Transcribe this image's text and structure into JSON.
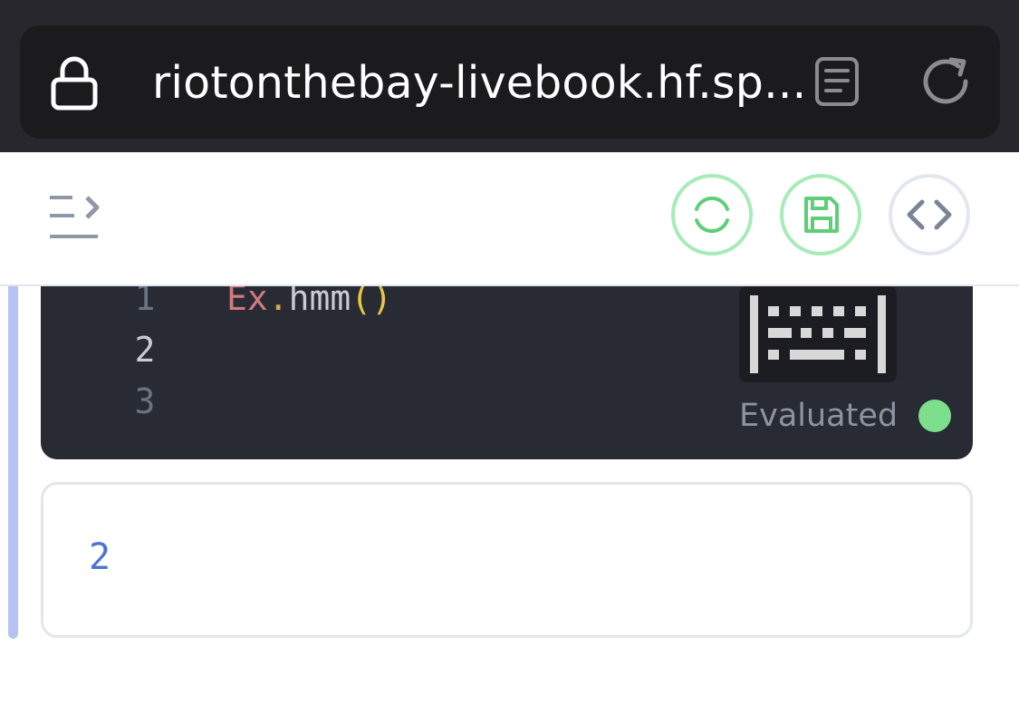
{
  "browser": {
    "url": "riotonthebay-livebook.hf.sp...",
    "icons": {
      "lock": "lock-icon",
      "reader": "reader-mode-icon",
      "reload": "reload-icon"
    }
  },
  "header": {
    "icons": {
      "sidebar_toggle": "sidebar-toggle-icon",
      "reconnect": "reconnect-runtime-icon",
      "save": "save-icon",
      "code": "code-icon"
    }
  },
  "code_cell": {
    "line_numbers": [
      "1",
      "2",
      "3"
    ],
    "tokens": {
      "module": "Ex",
      "dot": ".",
      "function": "hmm",
      "parens": "()"
    },
    "status": "Evaluated",
    "status_color": "#7ddf8c"
  },
  "output_cell": {
    "value": "2"
  },
  "colors": {
    "accent_green": "#a6ecb7",
    "section_bar": "#b7c3f3",
    "output_number": "#4b73d6"
  }
}
